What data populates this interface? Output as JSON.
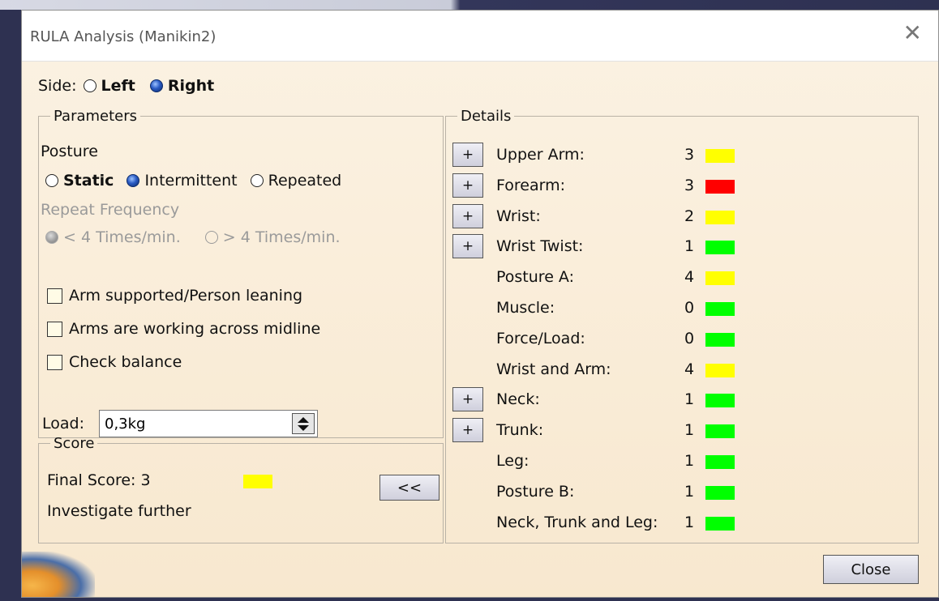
{
  "window": {
    "title": "RULA Analysis (Manikin2)",
    "close_glyph": "✕"
  },
  "side": {
    "label": "Side:",
    "options": [
      {
        "label": "Left",
        "checked": false
      },
      {
        "label": "Right",
        "checked": true
      }
    ]
  },
  "parameters": {
    "legend": "Parameters",
    "posture_label": "Posture",
    "posture_options": [
      {
        "label": "Static",
        "checked": false
      },
      {
        "label": "Intermittent",
        "checked": true
      },
      {
        "label": "Repeated",
        "checked": false
      }
    ],
    "repeat_label": "Repeat Frequency",
    "repeat_options": [
      {
        "label": "< 4 Times/min.",
        "checked": true
      },
      {
        "label": "> 4 Times/min.",
        "checked": false
      }
    ],
    "checkboxes": [
      {
        "label": "Arm supported/Person leaning",
        "checked": false
      },
      {
        "label": "Arms are working across midline",
        "checked": false
      },
      {
        "label": "Check balance",
        "checked": false
      }
    ],
    "load_label": "Load:",
    "load_value": "0,3kg"
  },
  "score": {
    "legend": "Score",
    "final_label": "Final Score: 3",
    "final_color": "#ffff00",
    "message": "Investigate further",
    "collapse_button": "<<"
  },
  "details": {
    "legend": "Details",
    "plus_label": "+",
    "rows": [
      {
        "label": "Upper Arm:",
        "value": "3",
        "color": "#ffff00",
        "expandable": true
      },
      {
        "label": "Forearm:",
        "value": "3",
        "color": "#ff0000",
        "expandable": true
      },
      {
        "label": "Wrist:",
        "value": "2",
        "color": "#ffff00",
        "expandable": true
      },
      {
        "label": "Wrist Twist:",
        "value": "1",
        "color": "#00ff00",
        "expandable": true
      },
      {
        "label": "Posture A:",
        "value": "4",
        "color": "#ffff00",
        "expandable": false
      },
      {
        "label": "Muscle:",
        "value": "0",
        "color": "#00ff00",
        "expandable": false
      },
      {
        "label": "Force/Load:",
        "value": "0",
        "color": "#00ff00",
        "expandable": false
      },
      {
        "label": "Wrist and Arm:",
        "value": "4",
        "color": "#ffff00",
        "expandable": false
      },
      {
        "label": "Neck:",
        "value": "1",
        "color": "#00ff00",
        "expandable": true
      },
      {
        "label": "Trunk:",
        "value": "1",
        "color": "#00ff00",
        "expandable": true
      },
      {
        "label": "Leg:",
        "value": "1",
        "color": "#00ff00",
        "expandable": false
      },
      {
        "label": "Posture B:",
        "value": "1",
        "color": "#00ff00",
        "expandable": false
      },
      {
        "label": "Neck, Trunk and Leg:",
        "value": "1",
        "color": "#00ff00",
        "expandable": false
      }
    ]
  },
  "footer": {
    "close_button": "Close"
  }
}
